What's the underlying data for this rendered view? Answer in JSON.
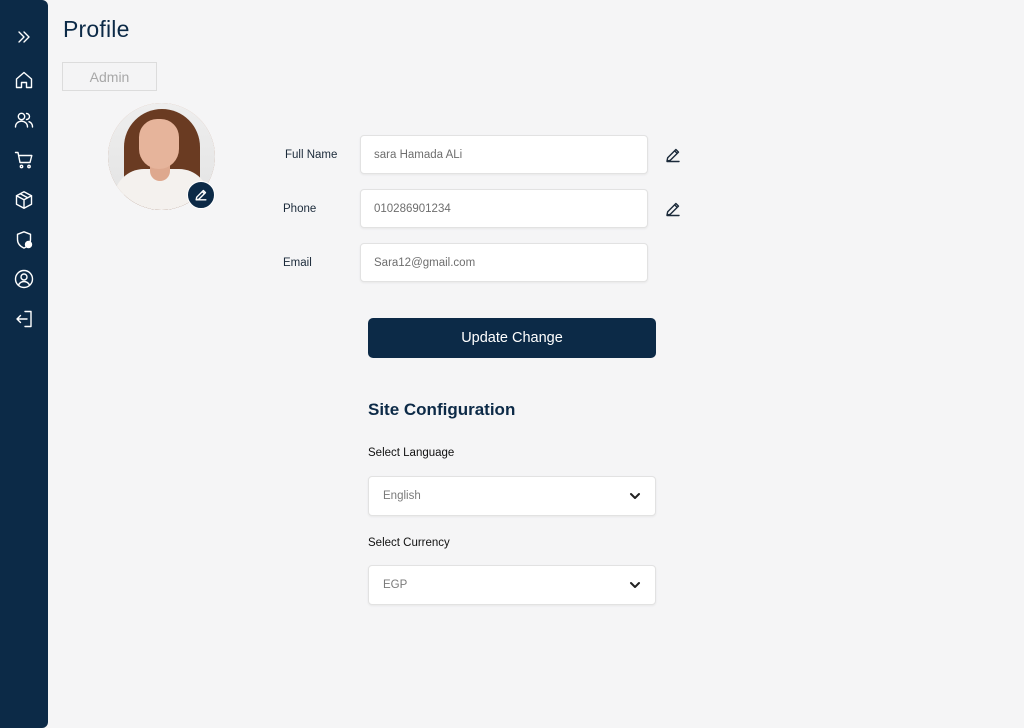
{
  "header": {
    "title": "Profile",
    "role_tab": "Admin"
  },
  "sidebar": {
    "items": [
      {
        "icon": "double-chevron-right-icon"
      },
      {
        "icon": "home-icon"
      },
      {
        "icon": "users-icon"
      },
      {
        "icon": "cart-icon"
      },
      {
        "icon": "box-icon"
      },
      {
        "icon": "shield-lock-icon"
      },
      {
        "icon": "user-circle-icon"
      },
      {
        "icon": "logout-icon"
      }
    ]
  },
  "profile": {
    "full_name_label": "Full Name",
    "full_name_value": "sara Hamada ALi",
    "phone_label": "Phone",
    "phone_value": "010286901234",
    "email_label": "Email",
    "email_value": "Sara12@gmail.com",
    "update_button": "Update Change"
  },
  "site_config": {
    "title": "Site Configuration",
    "language_label": "Select Language",
    "language_value": "English",
    "currency_label": "Select Currency",
    "currency_value": "EGP"
  },
  "colors": {
    "primary": "#0c2a47",
    "background": "#f5f5f6"
  }
}
